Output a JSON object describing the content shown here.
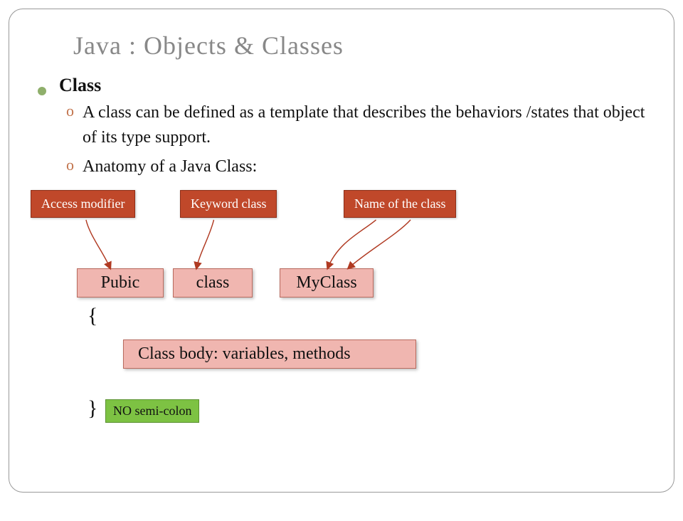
{
  "title": "Java : Objects & Classes",
  "main_bullet": "Class",
  "sub_points": [
    "A class can be defined as a template that describes the  behaviors /states that object of its type support.",
    "Anatomy of a Java Class:"
  ],
  "labels": {
    "access_modifier": "Access modifier",
    "keyword_class": "Keyword class",
    "name_of_class": "Name of  the class"
  },
  "tokens": {
    "public": "Pubic",
    "class": "class",
    "myclass": "MyClass",
    "body": "Class body: variables, methods"
  },
  "braces": {
    "open": "{",
    "close": "}"
  },
  "note": "NO semi-colon"
}
